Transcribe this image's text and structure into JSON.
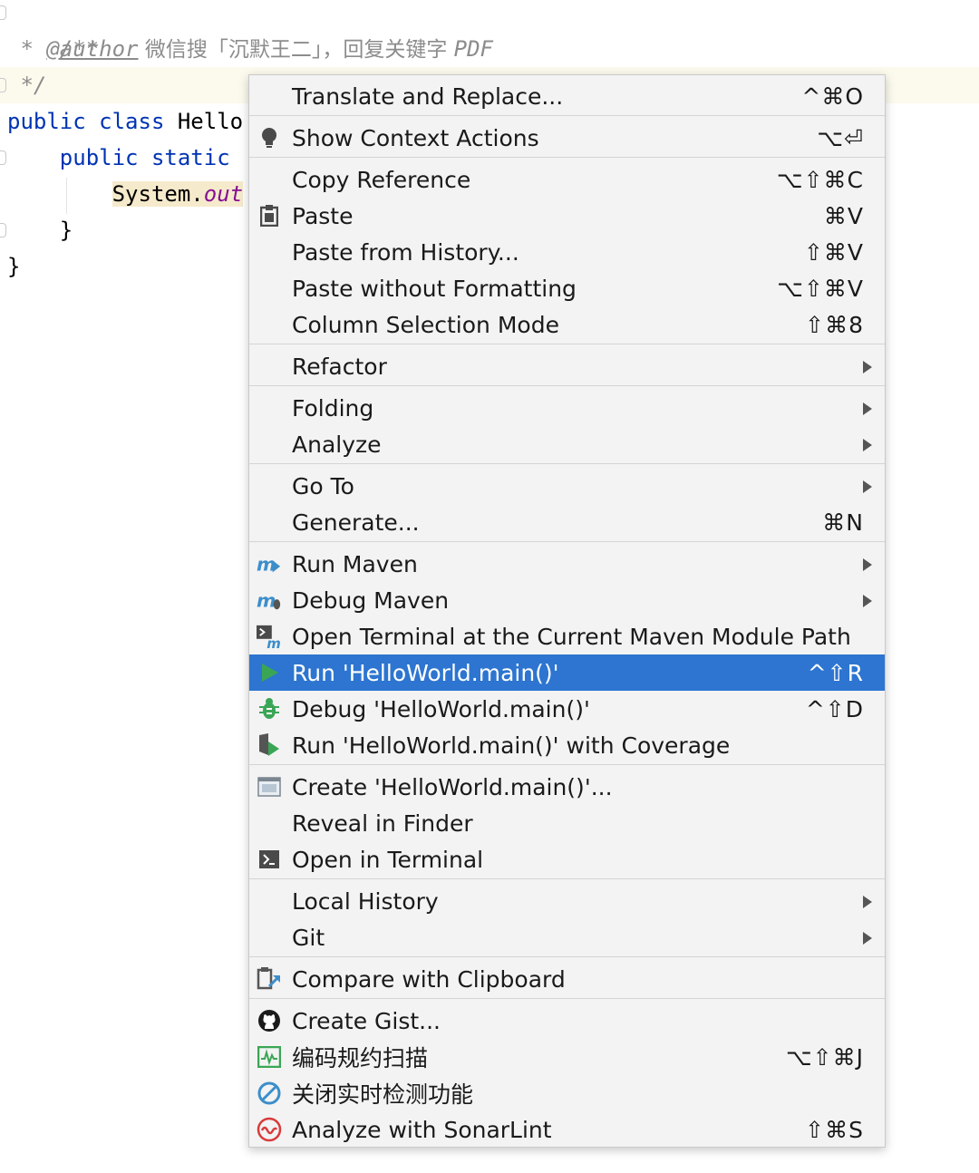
{
  "editor": {
    "comment_open": "/**",
    "comment_star": "* ",
    "author_tag": "@author",
    "comment_cn": " 微信搜「沉默王二」，回复关键字 ",
    "comment_pdf": "PDF",
    "comment_close": "*/",
    "kw_public": "public",
    "kw_class": "class",
    "class_name": "Hello",
    "kw_static": "static",
    "system_text": "System.",
    "field_text": "out",
    "brace_inner": "}",
    "brace_outer": "}"
  },
  "menu": {
    "items": [
      {
        "label": "Translate and Replace...",
        "shortcut": "^⌘O",
        "icon": ""
      },
      {
        "label": "Show Context Actions",
        "shortcut": "⌥⏎",
        "icon": "lightbulb-icon"
      },
      {
        "label": "Copy Reference",
        "shortcut": "⌥⇧⌘C",
        "icon": ""
      },
      {
        "label": "Paste",
        "shortcut": "⌘V",
        "icon": "clipboard-icon"
      },
      {
        "label": "Paste from History...",
        "shortcut": "⇧⌘V",
        "icon": ""
      },
      {
        "label": "Paste without Formatting",
        "shortcut": "⌥⇧⌘V",
        "icon": ""
      },
      {
        "label": "Column Selection Mode",
        "shortcut": "⇧⌘8",
        "icon": ""
      },
      {
        "label": "Refactor",
        "shortcut": "",
        "icon": "",
        "submenu": true
      },
      {
        "label": "Folding",
        "shortcut": "",
        "icon": "",
        "submenu": true
      },
      {
        "label": "Analyze",
        "shortcut": "",
        "icon": "",
        "submenu": true
      },
      {
        "label": "Go To",
        "shortcut": "",
        "icon": "",
        "submenu": true
      },
      {
        "label": "Generate...",
        "shortcut": "⌘N",
        "icon": ""
      },
      {
        "label": "Run Maven",
        "shortcut": "",
        "icon": "maven-run-icon",
        "submenu": true
      },
      {
        "label": "Debug Maven",
        "shortcut": "",
        "icon": "maven-debug-icon",
        "submenu": true
      },
      {
        "label": "Open Terminal at the Current Maven Module Path",
        "shortcut": "",
        "icon": "maven-terminal-icon"
      },
      {
        "label": "Run 'HelloWorld.main()'",
        "shortcut": "^⇧R",
        "icon": "run-icon",
        "selected": true
      },
      {
        "label": "Debug 'HelloWorld.main()'",
        "shortcut": "^⇧D",
        "icon": "debug-bug-icon"
      },
      {
        "label": "Run 'HelloWorld.main()' with Coverage",
        "shortcut": "",
        "icon": "coverage-icon"
      },
      {
        "label": "Create 'HelloWorld.main()'...",
        "shortcut": "",
        "icon": "run-config-icon"
      },
      {
        "label": "Reveal in Finder",
        "shortcut": "",
        "icon": ""
      },
      {
        "label": "Open in Terminal",
        "shortcut": "",
        "icon": "terminal-icon"
      },
      {
        "label": "Local History",
        "shortcut": "",
        "icon": "",
        "submenu": true
      },
      {
        "label": "Git",
        "shortcut": "",
        "icon": "",
        "submenu": true
      },
      {
        "label": "Compare with Clipboard",
        "shortcut": "",
        "icon": "compare-clipboard-icon"
      },
      {
        "label": "Create Gist...",
        "shortcut": "",
        "icon": "github-icon"
      },
      {
        "label": "编码规约扫描",
        "shortcut": "⌥⇧⌘J",
        "icon": "code-scan-icon"
      },
      {
        "label": "关闭实时检测功能",
        "shortcut": "",
        "icon": "disable-detection-icon"
      },
      {
        "label": "Analyze with SonarLint",
        "shortcut": "⇧⌘S",
        "icon": "sonarlint-icon"
      }
    ]
  },
  "colors": {
    "selection": "#2d75d0",
    "keyword": "#0033b3",
    "comment": "#8c8c8c",
    "run_green": "#3aa655",
    "maven_blue": "#3c8ecb",
    "sonar_red": "#d93a3a"
  }
}
